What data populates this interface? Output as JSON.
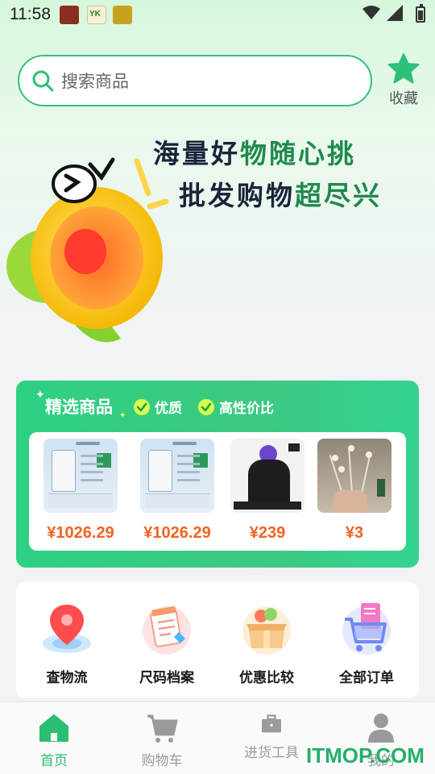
{
  "status_bar": {
    "time": "11:58",
    "notification_icons": [
      "app-notification-icon",
      "yk-app-notification-icon",
      "app-notification-icon"
    ],
    "system_icons": [
      "wifi-icon",
      "cellular-signal-icon",
      "battery-icon"
    ]
  },
  "header": {
    "search": {
      "placeholder": "搜索商品",
      "icon": "search-icon"
    },
    "favorites": {
      "label": "收藏",
      "icon": "star-icon"
    }
  },
  "banner": {
    "line1": {
      "dark": "海量好",
      "highlight": "物随心挑"
    },
    "line2": {
      "dark": "批发购物",
      "highlight": "超尽兴"
    },
    "illustration": "megaphone-mascot"
  },
  "featured": {
    "title": "精选商品",
    "tags": [
      {
        "label": "优质",
        "icon": "check-circle-icon"
      },
      {
        "label": "高性价比",
        "icon": "check-circle-icon"
      }
    ],
    "products": [
      {
        "price": "¥1026.29",
        "image": "spec-sheet-device"
      },
      {
        "price": "¥1026.29",
        "image": "spec-sheet-device"
      },
      {
        "price": "¥239",
        "image": "black-jacket"
      },
      {
        "price": "¥3",
        "image": "dried-flower-bouquet"
      }
    ],
    "colors": {
      "accent": "#2ed183",
      "price": "#f26322"
    }
  },
  "quick_actions": [
    {
      "label": "查物流",
      "icon": "location-pin-icon"
    },
    {
      "label": "尺码档案",
      "icon": "notepad-icon"
    },
    {
      "label": "优惠比较",
      "icon": "gift-box-icon"
    },
    {
      "label": "全部订单",
      "icon": "shopping-cart-orders-icon"
    }
  ],
  "bottom_nav": [
    {
      "label": "首页",
      "icon": "home-icon",
      "active": true
    },
    {
      "label": "购物车",
      "icon": "cart-icon",
      "active": false
    },
    {
      "label": "进货工具",
      "icon": "toolbox-icon",
      "active": false
    },
    {
      "label": "我的",
      "icon": "user-icon",
      "active": false
    }
  ],
  "watermark": "ITMOP.COM"
}
